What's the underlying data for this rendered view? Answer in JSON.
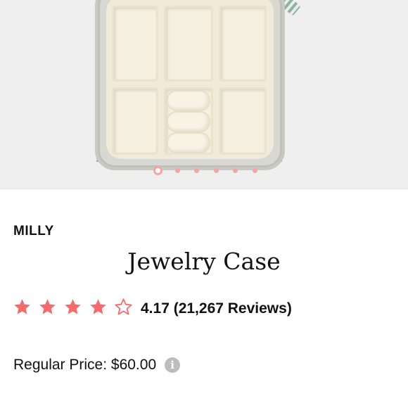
{
  "product": {
    "brand": "MILLY",
    "title": "Jewelry Case",
    "rating": {
      "value": 4.17,
      "max": 5,
      "filled_stars": 4,
      "text": "4.17 (21,267 Reviews)"
    },
    "price_text": "Regular Price: $60.00"
  },
  "carousel": {
    "total": 6,
    "active_index": 0
  },
  "icons": {
    "star": "star-icon",
    "star_outline": "star-outline-icon",
    "info": "info-icon"
  },
  "colors": {
    "accent": "#f56a6a",
    "dot": "#f3a7a5",
    "image_bg": "#efefef"
  }
}
